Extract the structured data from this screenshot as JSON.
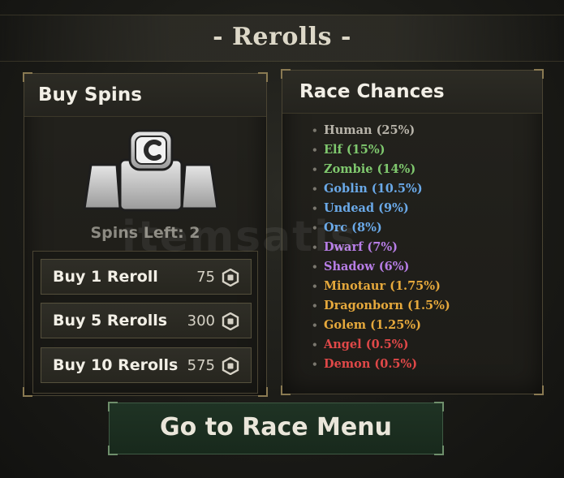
{
  "header": {
    "title": "- Rerolls -"
  },
  "buy_spins": {
    "title": "Buy Spins",
    "spins_left": "Spins Left: 2",
    "buttons": [
      {
        "label": "Buy 1 Reroll",
        "price": "75"
      },
      {
        "label": "Buy 5 Rerolls",
        "price": "300"
      },
      {
        "label": "Buy 10 Rerolls",
        "price": "575"
      }
    ]
  },
  "race_chances": {
    "title": "Race Chances",
    "races": [
      {
        "text": "Human (25%)",
        "color": "#b8b4aa"
      },
      {
        "text": "Elf (15%)",
        "color": "#7fc86e"
      },
      {
        "text": "Zombie (14%)",
        "color": "#7fc86e"
      },
      {
        "text": "Goblin (10.5%)",
        "color": "#6aa9e8"
      },
      {
        "text": "Undead (9%)",
        "color": "#6aa9e8"
      },
      {
        "text": "Orc (8%)",
        "color": "#6aa9e8"
      },
      {
        "text": "Dwarf (7%)",
        "color": "#b77de6"
      },
      {
        "text": "Shadow (6%)",
        "color": "#b77de6"
      },
      {
        "text": "Minotaur (1.75%)",
        "color": "#e6a93c"
      },
      {
        "text": "Dragonborn (1.5%)",
        "color": "#e6a93c"
      },
      {
        "text": "Golem (1.25%)",
        "color": "#e6a93c"
      },
      {
        "text": "Angel (0.5%)",
        "color": "#e04848"
      },
      {
        "text": "Demon (0.5%)",
        "color": "#e04848"
      }
    ]
  },
  "footer": {
    "go_button": "Go to Race Menu"
  },
  "watermark": "itemsatis",
  "icons": {
    "currency": "robux-coin-icon",
    "spin": "spin-token-icon"
  }
}
